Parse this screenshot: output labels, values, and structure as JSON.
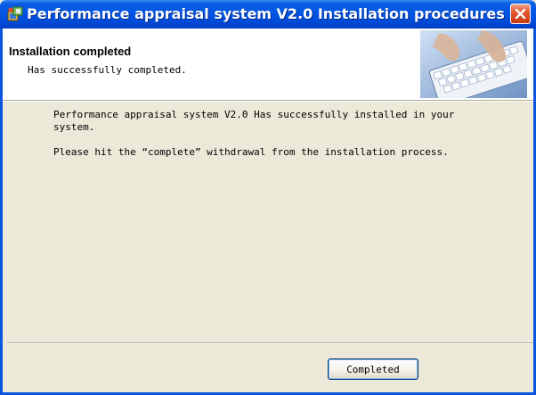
{
  "window": {
    "title": "Performance appraisal system V2.0 Installation procedures",
    "icon": "setup-icon",
    "close_icon": "close-icon"
  },
  "header": {
    "title": "Installation completed",
    "subtitle": "Has successfully completed.",
    "image": "keyboard-hands-image"
  },
  "body": {
    "line1": "Performance appraisal system V2.0 Has successfully installed in your",
    "line2": "system.",
    "line3": "Please hit the “complete” withdrawal from the installation process."
  },
  "footer": {
    "complete_label": "Completed"
  },
  "colors": {
    "titlebar": "#0055e5",
    "dialog_bg": "#ece9d8",
    "close_button": "#e2592e"
  }
}
